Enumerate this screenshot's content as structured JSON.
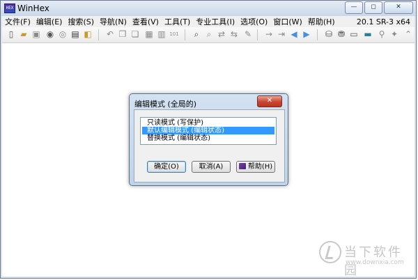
{
  "window": {
    "title": "WinHex",
    "icon": "winhex-app-icon"
  },
  "caption": {
    "minimize": "—",
    "restore": "◻",
    "close": "✕"
  },
  "menu": {
    "items": [
      "文件(F)",
      "编辑(E)",
      "搜索(S)",
      "导航(N)",
      "查看(V)",
      "工具(T)",
      "专业工具(I)",
      "选项(O)",
      "窗口(W)",
      "帮助(H)"
    ],
    "version": "20.1 SR-3 x64"
  },
  "toolbar": {
    "icons": [
      "new-file-icon",
      "open-file-icon",
      "save-icon",
      "open-disk-icon",
      "save-disk-icon",
      "properties-icon",
      "export-icon",
      "undo-icon",
      "copy-icon",
      "paste-icon",
      "copy-block-icon",
      "paste-block-icon",
      "binary-icon",
      "find-icon",
      "find-hex-icon",
      "replace-icon",
      "replace-hex-icon",
      "find-next-icon",
      "goto-offset-icon",
      "goto-sector-icon",
      "back-icon",
      "forward-icon",
      "disk-editor-icon",
      "ram-editor-icon",
      "hex-calculator-icon",
      "template-icon",
      "zoom-icon",
      "wand-icon"
    ]
  },
  "dialog": {
    "title": "编辑模式 (全局的)",
    "options": [
      {
        "label": "只读模式 (写保护)",
        "selected": false
      },
      {
        "label": "默认编辑模式 (编辑状态)",
        "selected": true
      },
      {
        "label": "替换模式 (编辑状态)",
        "selected": false
      }
    ],
    "ok_label": "确定(O)",
    "cancel_label": "取消(A)",
    "help_label": "帮助(H)"
  },
  "watermark": {
    "name": "当下软件园",
    "url": "www.downxia.com"
  },
  "colors": {
    "selection": "#3399ff",
    "close_button": "#c9452f",
    "frame": "#dbe4ee"
  }
}
